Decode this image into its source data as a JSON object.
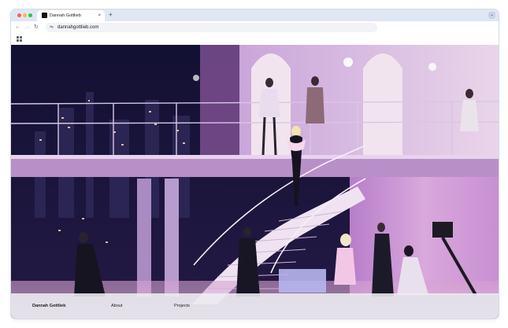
{
  "browser": {
    "tab_title": "Dannah Gottlieb",
    "tab_close": "×",
    "new_tab": "+",
    "tab_menu": "⌄",
    "back": "←",
    "forward": "→",
    "reload": "↻",
    "site_settings": "⇋",
    "url": "dannahgottlieb.com"
  },
  "site": {
    "brand": "Dannah Gottlieb",
    "nav": [
      {
        "label": "About"
      },
      {
        "label": "Projects"
      }
    ]
  },
  "hero": {
    "image": "stage-performance-photo",
    "colors": {
      "night_sky": "#140f2e",
      "stage_pink": "#e6a9d6",
      "curtain": "#b58ad0"
    }
  },
  "icons": {
    "apps": "apps-grid-icon",
    "favicon": "site-favicon"
  }
}
